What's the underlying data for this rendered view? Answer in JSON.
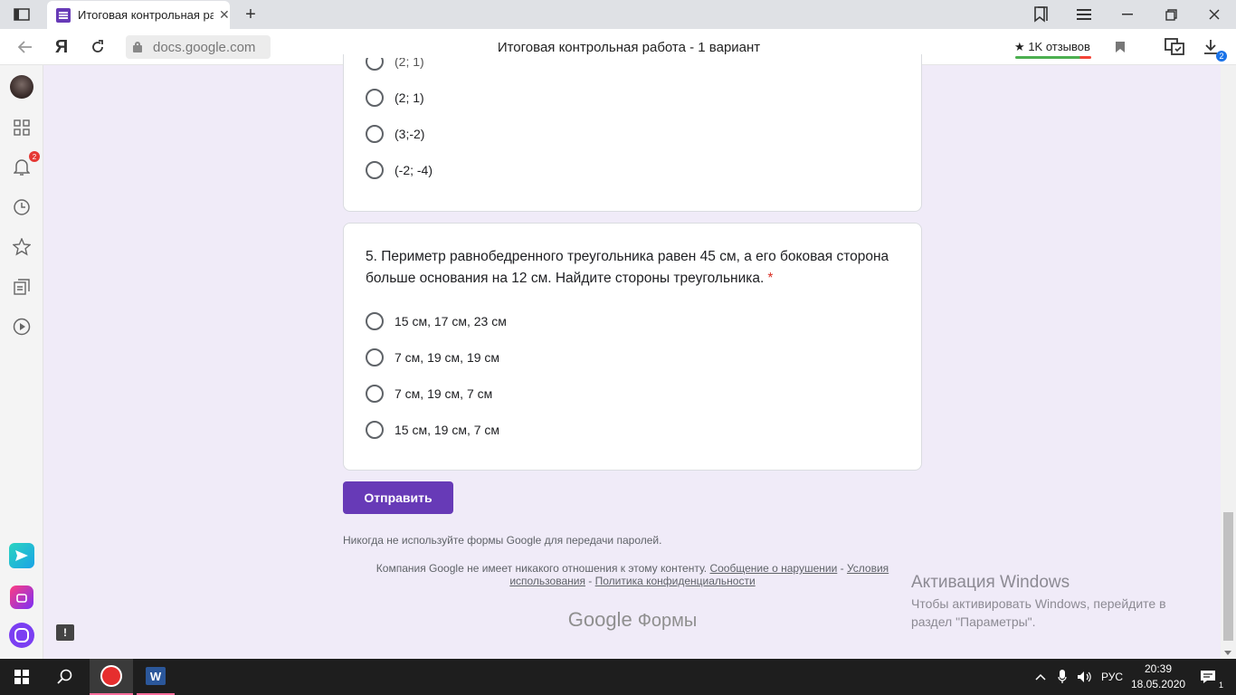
{
  "browser": {
    "tab_title": "Итоговая контрольная ра",
    "url": "docs.google.com",
    "page_title": "Итоговая контрольная работа - 1 вариант",
    "reviews_label": "★ 1K отзывов",
    "downloads_count": "2",
    "ya_logo": "Я"
  },
  "sidebar": {
    "notifications_count": "2"
  },
  "question4": {
    "options": [
      "(2; 1)",
      "(3;-2)",
      "(-2; -4)"
    ]
  },
  "question5": {
    "text": "5. Периметр равнобедренного треугольника равен 45 см, а его боковая сторона больше основания на 12 см. Найдите стороны треугольника.",
    "required_mark": "*",
    "options": [
      "15 см, 17 см, 23 см",
      "7 см, 19 см, 19 см",
      "7 см, 19 см, 7 см",
      "15 см, 19 см, 7 см"
    ]
  },
  "form": {
    "submit_label": "Отправить",
    "password_warning": "Никогда не используйте формы Google для передачи паролей.",
    "footer_text": "Компания Google не имеет никакого отношения к этому контенту.",
    "footer_links": {
      "abuse": "Сообщение о нарушении",
      "sep1": " - ",
      "terms": "Условия использования",
      "sep2": " - ",
      "privacy": "Политика конфиденциальности"
    },
    "brand_google": "Google",
    "brand_forms": "Формы"
  },
  "watermark": {
    "title": "Активация Windows",
    "text": "Чтобы активировать Windows, перейдите в раздел \"Параметры\"."
  },
  "taskbar": {
    "language": "РУС",
    "time": "20:39",
    "date": "18.05.2020",
    "word_letter": "W",
    "notifications_count": "1"
  },
  "colors": {
    "form_accent": "#673ab7",
    "page_bg": "#f0ebf8",
    "required": "#d93025"
  }
}
